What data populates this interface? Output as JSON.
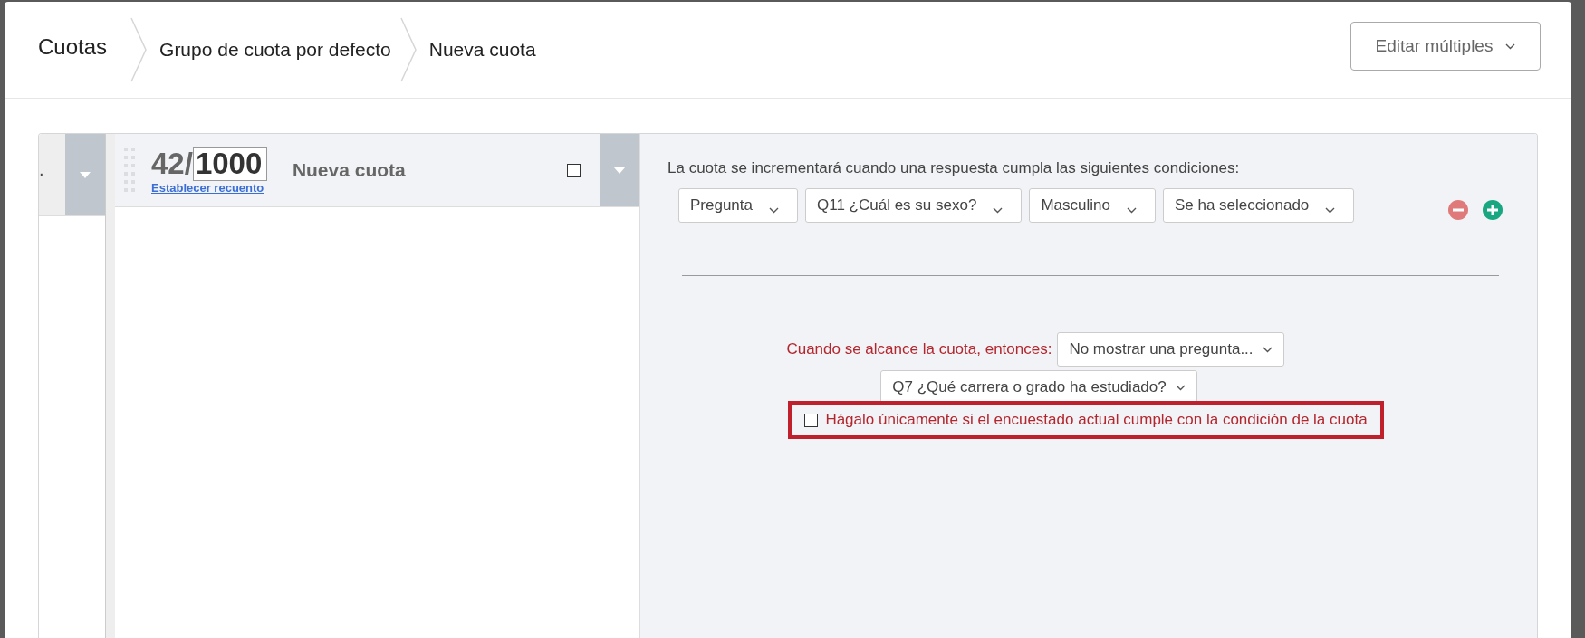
{
  "header": {
    "title": "Cuotas",
    "breadcrumbs": [
      {
        "label": "Grupo de cuota por defecto"
      },
      {
        "label": "Nueva cuota"
      }
    ],
    "edit_button": {
      "label": "Editar múltiples"
    }
  },
  "previous_quota": {
    "label": "."
  },
  "quota": {
    "count": "42/",
    "total": "1000",
    "set_count_link": "Establecer recuento",
    "name": "Nueva cuota",
    "checked": false
  },
  "conditions": {
    "intro": "La cuota se incrementará cuando una respuesta cumpla las siguientes condiciones:",
    "rows": [
      {
        "fields": [
          "Pregunta",
          "Q11 ¿Cuál es su sexo?",
          "Masculino",
          "Se ha seleccionado"
        ]
      }
    ]
  },
  "action": {
    "label": "Cuando se alcance la cuota, entonces:",
    "action_select": "No mostrar una pregunta...",
    "question_select": "Q7 ¿Qué carrera o grado ha estudiado?",
    "only_if": {
      "label": "Hágalo únicamente si el encuestado actual cumple con la condición de la cuota",
      "checked": false
    }
  }
}
